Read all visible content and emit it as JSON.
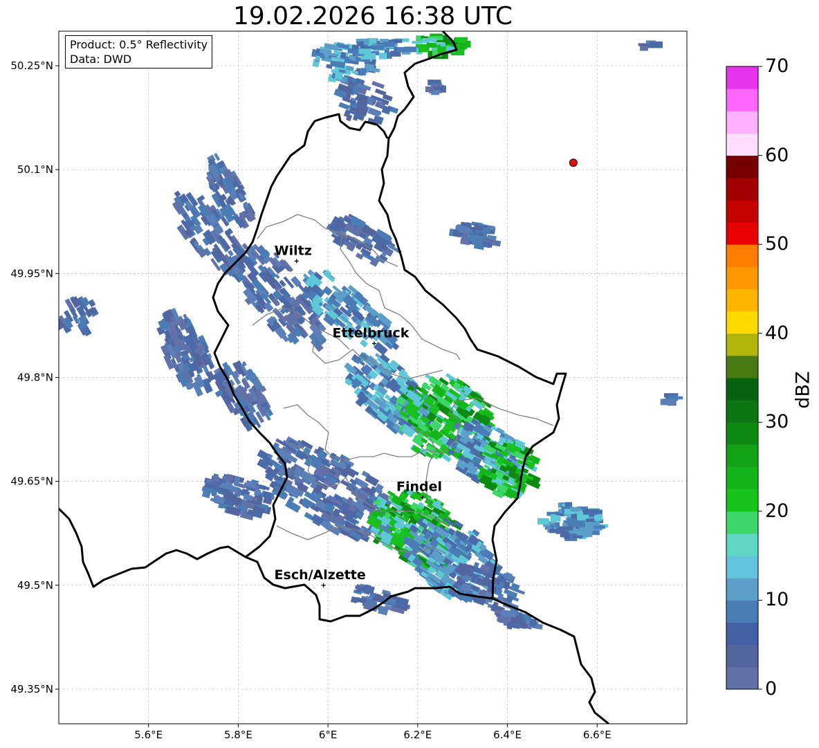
{
  "title": "19.02.2026 16:38 UTC",
  "info": {
    "product": "Product: 0.5° Reflectivity",
    "data": "Data: DWD"
  },
  "axes": {
    "lon_ticks": [
      {
        "value": 5.6,
        "label": "5.6°E"
      },
      {
        "value": 5.8,
        "label": "5.8°E"
      },
      {
        "value": 6.0,
        "label": "6°E"
      },
      {
        "value": 6.2,
        "label": "6.2°E"
      },
      {
        "value": 6.4,
        "label": "6.4°E"
      },
      {
        "value": 6.6,
        "label": "6.6°E"
      }
    ],
    "lat_ticks": [
      {
        "value": 50.25,
        "label": "50.25°N"
      },
      {
        "value": 50.1,
        "label": "50.1°N"
      },
      {
        "value": 49.95,
        "label": "49.95°N"
      },
      {
        "value": 49.8,
        "label": "49.8°N"
      },
      {
        "value": 49.65,
        "label": "49.65°N"
      },
      {
        "value": 49.5,
        "label": "49.5°N"
      },
      {
        "value": 49.35,
        "label": "49.35°N"
      }
    ],
    "lon_range": [
      5.4,
      6.8
    ],
    "lat_range": [
      49.3,
      50.3
    ]
  },
  "cities": [
    {
      "name": "Wiltz",
      "lon": 5.93,
      "lat": 49.968
    },
    {
      "name": "Ettelbruck",
      "lon": 6.103,
      "lat": 49.849
    },
    {
      "name": "Findel",
      "lon": 6.211,
      "lat": 49.627
    },
    {
      "name": "Esch/Alzette",
      "lon": 5.99,
      "lat": 49.5
    }
  ],
  "radar_marker": {
    "lon": 6.547,
    "lat": 50.11,
    "color": "#e01010"
  },
  "colorbar": {
    "label": "dBZ",
    "tick_labels": [
      "70",
      "60",
      "50",
      "40",
      "30",
      "20",
      "10",
      "0"
    ],
    "colors": [
      "#6272a8",
      "#52659e",
      "#4460a5",
      "#4a7db5",
      "#5b9ec8",
      "#63c2dc",
      "#5fd6c2",
      "#3dd66a",
      "#16c41c",
      "#14b51a",
      "#12a216",
      "#0e8a13",
      "#0b7612",
      "#086310",
      "#477a13",
      "#b0b40b",
      "#ffd800",
      "#ffb400",
      "#ff9800",
      "#ff7c00",
      "#e60000",
      "#c40000",
      "#a20000",
      "#760000",
      "#ffdeff",
      "#ffb0ff",
      "#ff66ff",
      "#e833ec"
    ]
  },
  "legend_colors": {
    "rain_light": "#4a6aa8",
    "rain_mid": "#5fc8d8",
    "rain_heavy": "#18c020"
  }
}
